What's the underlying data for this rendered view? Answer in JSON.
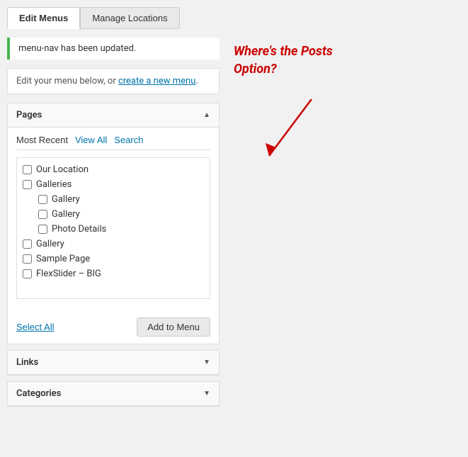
{
  "tabs": {
    "edit_menus": "Edit Menus",
    "manage_locations": "Manage Locations"
  },
  "notice": {
    "text": "menu-nav has been updated."
  },
  "info": {
    "prefix": "Edit your menu below, or ",
    "link_text": "create a new menu",
    "suffix": "."
  },
  "pages_panel": {
    "title": "Pages",
    "subtabs": [
      "Most Recent",
      "View All",
      "Search"
    ],
    "items": [
      {
        "label": "Our Location",
        "indented": false
      },
      {
        "label": "Galleries",
        "indented": false
      },
      {
        "label": "Gallery",
        "indented": true
      },
      {
        "label": "Gallery",
        "indented": true
      },
      {
        "label": "Photo Details",
        "indented": true
      },
      {
        "label": "Gallery",
        "indented": false
      },
      {
        "label": "Sample Page",
        "indented": false
      },
      {
        "label": "FlexSlider – BIG",
        "indented": false
      }
    ],
    "select_all": "Select All",
    "add_to_menu": "Add to Menu"
  },
  "links_panel": {
    "title": "Links"
  },
  "categories_panel": {
    "title": "Categories"
  },
  "annotation": {
    "line1": "Where's the Posts",
    "line2": "Option?"
  }
}
